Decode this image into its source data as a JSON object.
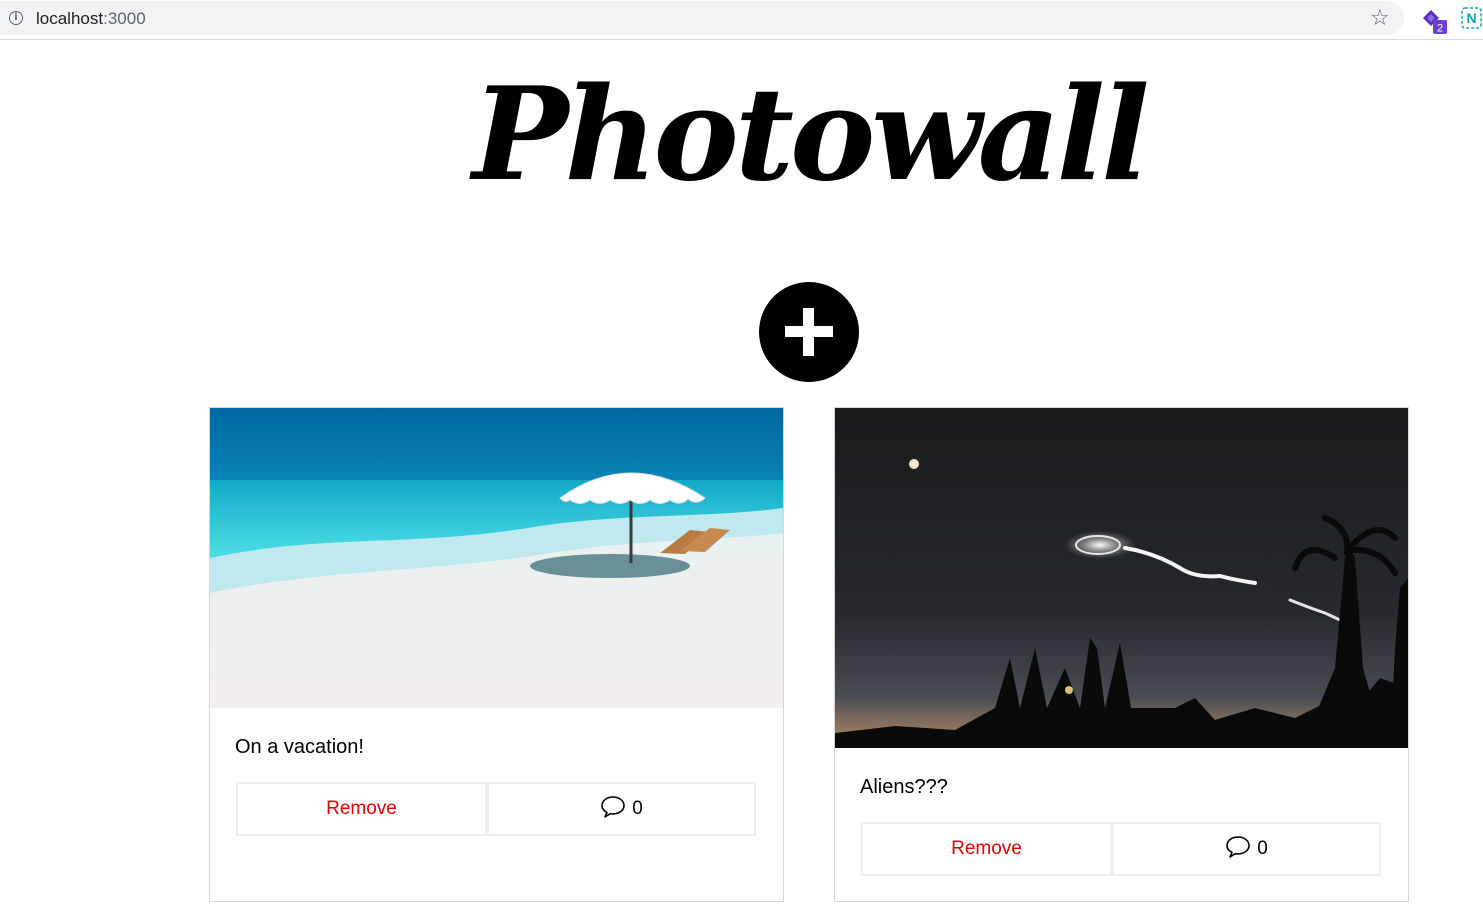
{
  "browser": {
    "url_host": "localhost",
    "url_port": ":3000",
    "extension_badge": "2",
    "extension2_letter": "N"
  },
  "app": {
    "title": "Photowall"
  },
  "posts": [
    {
      "caption": "On a vacation!",
      "remove_label": "Remove",
      "comment_count": "0"
    },
    {
      "caption": "Aliens???",
      "remove_label": "Remove",
      "comment_count": "0"
    }
  ],
  "colors": {
    "remove": "#e00000",
    "add_button": "#000000"
  }
}
